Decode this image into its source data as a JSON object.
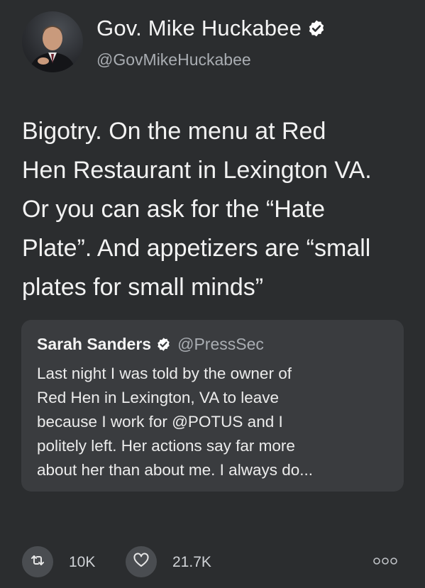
{
  "tweet": {
    "author": {
      "display_name": "Gov. Mike Huckabee",
      "handle": "@GovMikeHuckabee",
      "verified": true
    },
    "text_lines": [
      "Bigotry. On the menu at Red",
      "Hen Restaurant in Lexington VA.",
      "Or you can ask for the “Hate",
      "Plate”.  And appetizers are “small",
      "plates for small minds”"
    ]
  },
  "quoted_tweet": {
    "author": {
      "display_name": "Sarah Sanders",
      "handle": "@PressSec",
      "verified": true
    },
    "text_lines": [
      "Last night I was told by the owner of",
      "Red Hen in Lexington, VA to leave",
      "because I work for @POTUS and I",
      "politely left. Her actions say far more",
      "about her than about me. I always do..."
    ]
  },
  "actions": {
    "retweet_count": "10K",
    "like_count": "21.7K",
    "icons": [
      "retweet-icon",
      "heart-icon",
      "more-icon"
    ]
  },
  "colors": {
    "background": "#2b2d2f",
    "quote_background": "#3a3c3f",
    "verified_badge": "#ffffff",
    "secondary_text": "#a9adb2"
  }
}
